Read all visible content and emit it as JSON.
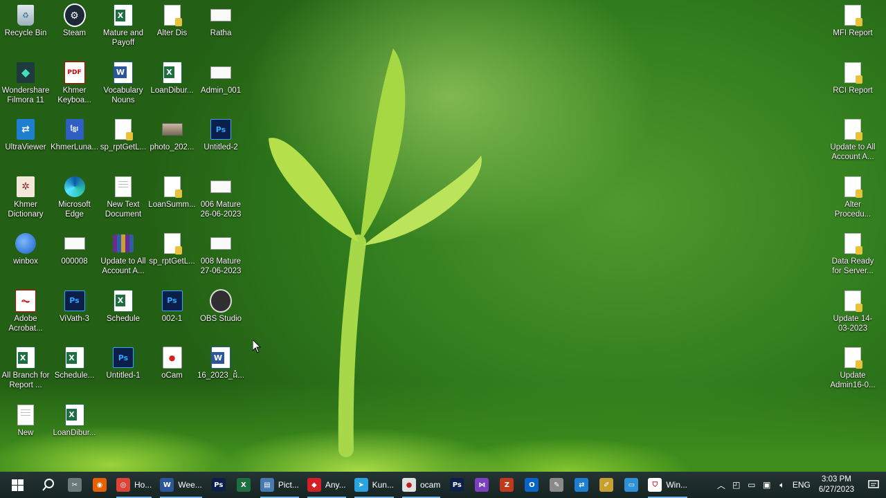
{
  "desktop": {
    "icons_left": [
      {
        "label": "Recycle Bin",
        "icon": "recycle-bin-icon"
      },
      {
        "label": "Steam",
        "icon": "steam-icon"
      },
      {
        "label": "Mature and Payoff",
        "icon": "excel-file-icon"
      },
      {
        "label": "Alter Dis",
        "icon": "sql-file-icon"
      },
      {
        "label": "Ratha",
        "icon": "blank-file-icon"
      },
      {
        "label": "Wondershare Filmora 11",
        "icon": "filmora-icon"
      },
      {
        "label": "Khmer Keyboa...",
        "icon": "pdf-icon"
      },
      {
        "label": "Vocabulary Nouns",
        "icon": "word-file-icon"
      },
      {
        "label": "LoanDibur...",
        "icon": "excel-file-icon"
      },
      {
        "label": "Admin_001",
        "icon": "blank-file-icon"
      },
      {
        "label": "UltraViewer",
        "icon": "ultraviewer-icon"
      },
      {
        "label": "KhmerLuna...",
        "icon": "khmer-lunar-icon"
      },
      {
        "label": "sp_rptGetL...",
        "icon": "sql-file-icon"
      },
      {
        "label": "photo_202...",
        "icon": "photo-icon"
      },
      {
        "label": "Untitled-2",
        "icon": "photoshop-file-icon"
      },
      {
        "label": "Khmer Dictionary",
        "icon": "dictionary-icon"
      },
      {
        "label": "Microsoft Edge",
        "icon": "edge-icon"
      },
      {
        "label": "New Text Document",
        "icon": "text-file-icon"
      },
      {
        "label": "LoanSumm...",
        "icon": "sql-file-icon"
      },
      {
        "label": "006 Mature 26-06-2023",
        "icon": "blank-file-icon"
      },
      {
        "label": "winbox",
        "icon": "winbox-icon"
      },
      {
        "label": "000008",
        "icon": "blank-file-icon"
      },
      {
        "label": "Update to All Account A...",
        "icon": "rar-archive-icon"
      },
      {
        "label": "sp_rptGetL...",
        "icon": "sql-file-icon"
      },
      {
        "label": "008 Mature 27-06-2023",
        "icon": "blank-file-icon"
      },
      {
        "label": "Adobe Acrobat...",
        "icon": "acrobat-icon"
      },
      {
        "label": "ViVath-3",
        "icon": "photoshop-file-icon"
      },
      {
        "label": "Schedule",
        "icon": "excel-file-icon"
      },
      {
        "label": "002-1",
        "icon": "photoshop-file-icon"
      },
      {
        "label": "OBS Studio",
        "icon": "obs-icon"
      },
      {
        "label": "All Branch for Report ...",
        "icon": "excel-file-icon"
      },
      {
        "label": "Schedule...",
        "icon": "excel-file-icon"
      },
      {
        "label": "Untitled-1",
        "icon": "photoshop-file-icon"
      },
      {
        "label": "oCam",
        "icon": "ocam-icon"
      },
      {
        "label": "16_2023_ដំ...",
        "icon": "word-file-icon"
      },
      {
        "label": "New",
        "icon": "text-file-icon"
      },
      {
        "label": "LoanDibur...",
        "icon": "excel-file-icon"
      }
    ],
    "icons_right": [
      {
        "label": "MFI Report",
        "icon": "sql-file-icon"
      },
      {
        "label": "RCI Report",
        "icon": "sql-file-icon"
      },
      {
        "label": "Update to All Account A...",
        "icon": "sql-file-icon"
      },
      {
        "label": "Alter Procedu...",
        "icon": "sql-file-icon"
      },
      {
        "label": "Data Ready for Server...",
        "icon": "sql-file-icon"
      },
      {
        "label": "Update 14-03-2023",
        "icon": "sql-file-icon"
      },
      {
        "label": "Update Admin16-0...",
        "icon": "sql-file-icon"
      }
    ]
  },
  "taskbar": {
    "apps": [
      {
        "label": "",
        "icon": "snipping-tool-icon",
        "color": "#6a7a7a"
      },
      {
        "label": "",
        "icon": "firefox-icon",
        "color": "#e66000"
      },
      {
        "label": "Ho...",
        "icon": "chrome-icon",
        "color": "#db4437"
      },
      {
        "label": "Wee...",
        "icon": "word-icon",
        "color": "#2b579a"
      },
      {
        "label": "",
        "icon": "photoshop-icon",
        "color": "#0b1f4a"
      },
      {
        "label": "",
        "icon": "excel-icon",
        "color": "#1d6f42"
      },
      {
        "label": "Pict...",
        "icon": "picture-viewer-icon",
        "color": "#4a78b0"
      },
      {
        "label": "Any...",
        "icon": "anydesk-icon",
        "color": "#d51f26"
      },
      {
        "label": "Kun...",
        "icon": "telegram-icon",
        "color": "#2aa3df"
      },
      {
        "label": "ocam",
        "icon": "ocam-icon",
        "color": "#e0e0e0"
      },
      {
        "label": "",
        "icon": "photoshop-icon",
        "color": "#0b1f4a"
      },
      {
        "label": "",
        "icon": "visual-studio-icon",
        "color": "#7b3fbf"
      },
      {
        "label": "",
        "icon": "filezilla-icon",
        "color": "#bf3a1a"
      },
      {
        "label": "",
        "icon": "outlook-icon",
        "color": "#0a64c8"
      },
      {
        "label": "",
        "icon": "pen-tool-icon",
        "color": "#8a8a8a"
      },
      {
        "label": "",
        "icon": "ultraviewer-icon",
        "color": "#1e7fd1"
      },
      {
        "label": "",
        "icon": "paint-icon",
        "color": "#c8a032"
      },
      {
        "label": "",
        "icon": "remote-desktop-icon",
        "color": "#2f8fd8"
      },
      {
        "label": "Win...",
        "icon": "windows-security-icon",
        "color": "#ffffff"
      }
    ],
    "tray": {
      "language": "ENG",
      "time": "3:03 PM",
      "date": "6/27/2023"
    }
  }
}
